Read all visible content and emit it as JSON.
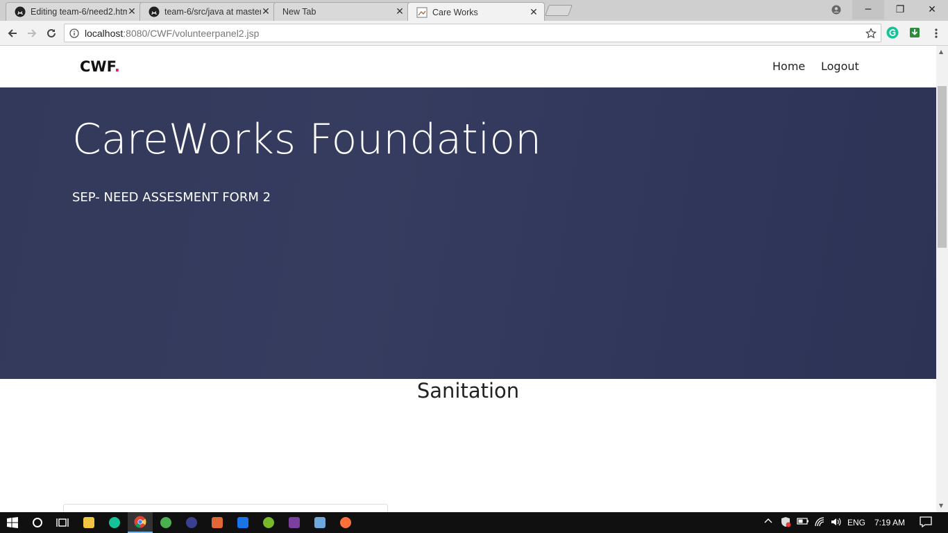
{
  "browser": {
    "tabs": [
      {
        "title": "Editing team-6/need2.htm",
        "active": false,
        "icon": "github-icon"
      },
      {
        "title": "team-6/src/java at master",
        "active": false,
        "icon": "github-icon"
      },
      {
        "title": "New Tab",
        "active": false,
        "icon": ""
      },
      {
        "title": "Care Works",
        "active": true,
        "icon": "page-icon"
      }
    ],
    "url_host": "localhost",
    "url_path": ":8080/CWF/volunteerpanel2.jsp"
  },
  "site": {
    "brand": "CWF",
    "brand_dot": ".",
    "nav": {
      "home": "Home",
      "logout": "Logout"
    },
    "hero_title": "CareWorks Foundation",
    "hero_subtitle": "SEP- NEED ASSESMENT FORM 2",
    "section_title": "Sanitation"
  },
  "taskbar": {
    "language": "ENG",
    "time": "7:19 AM"
  },
  "colors": {
    "hero_bg": "#33395a",
    "brand_dot": "#e0245e",
    "taskbar": "#101010"
  }
}
